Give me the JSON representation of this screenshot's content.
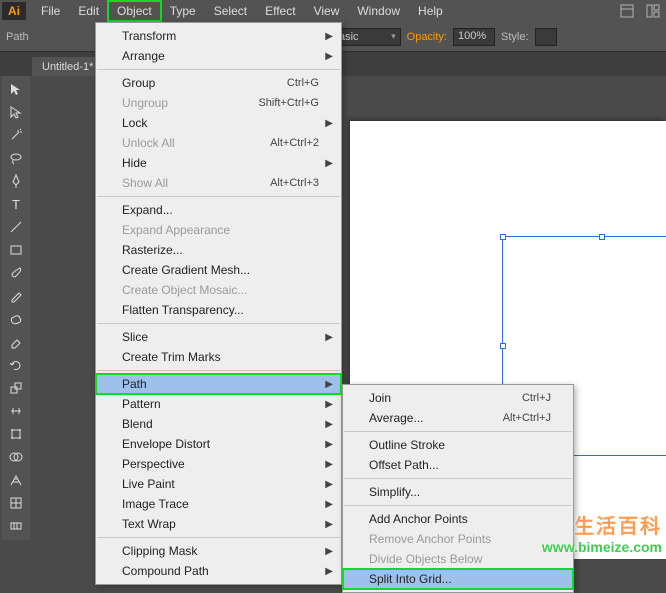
{
  "app_badge": "Ai",
  "menubar": [
    "File",
    "Edit",
    "Object",
    "Type",
    "Select",
    "Effect",
    "View",
    "Window",
    "Help"
  ],
  "active_menu_index": 2,
  "control_row": {
    "path_label": "Path",
    "basic_value": "Basic",
    "opacity_label": "Opacity:",
    "opacity_value": "100%",
    "style_label": "Style:"
  },
  "doc_tab": "Untitled-1*",
  "object_menu": [
    {
      "label": "Transform",
      "sub": true
    },
    {
      "label": "Arrange",
      "sub": true
    },
    {
      "sep": true
    },
    {
      "label": "Group",
      "shortcut": "Ctrl+G"
    },
    {
      "label": "Ungroup",
      "shortcut": "Shift+Ctrl+G",
      "disabled": true
    },
    {
      "label": "Lock",
      "sub": true
    },
    {
      "label": "Unlock All",
      "shortcut": "Alt+Ctrl+2",
      "disabled": true
    },
    {
      "label": "Hide",
      "sub": true
    },
    {
      "label": "Show All",
      "shortcut": "Alt+Ctrl+3",
      "disabled": true
    },
    {
      "sep": true
    },
    {
      "label": "Expand..."
    },
    {
      "label": "Expand Appearance",
      "disabled": true
    },
    {
      "label": "Rasterize..."
    },
    {
      "label": "Create Gradient Mesh..."
    },
    {
      "label": "Create Object Mosaic...",
      "disabled": true
    },
    {
      "label": "Flatten Transparency..."
    },
    {
      "sep": true
    },
    {
      "label": "Slice",
      "sub": true
    },
    {
      "label": "Create Trim Marks"
    },
    {
      "sep": true
    },
    {
      "label": "Path",
      "sub": true,
      "hl": true,
      "boxed": true
    },
    {
      "label": "Pattern",
      "sub": true
    },
    {
      "label": "Blend",
      "sub": true
    },
    {
      "label": "Envelope Distort",
      "sub": true
    },
    {
      "label": "Perspective",
      "sub": true
    },
    {
      "label": "Live Paint",
      "sub": true
    },
    {
      "label": "Image Trace",
      "sub": true
    },
    {
      "label": "Text Wrap",
      "sub": true
    },
    {
      "sep": true
    },
    {
      "label": "Clipping Mask",
      "sub": true
    },
    {
      "label": "Compound Path",
      "sub": true
    }
  ],
  "path_menu": [
    {
      "label": "Join",
      "shortcut": "Ctrl+J"
    },
    {
      "label": "Average...",
      "shortcut": "Alt+Ctrl+J"
    },
    {
      "sep": true
    },
    {
      "label": "Outline Stroke"
    },
    {
      "label": "Offset Path..."
    },
    {
      "sep": true
    },
    {
      "label": "Simplify..."
    },
    {
      "sep": true
    },
    {
      "label": "Add Anchor Points"
    },
    {
      "label": "Remove Anchor Points",
      "disabled": true
    },
    {
      "label": "Divide Objects Below",
      "disabled": true
    },
    {
      "label": "Split Into Grid...",
      "hl": true,
      "boxed": true
    }
  ],
  "watermark": {
    "cn": "生活百科",
    "en": "www.bimeize.com"
  }
}
